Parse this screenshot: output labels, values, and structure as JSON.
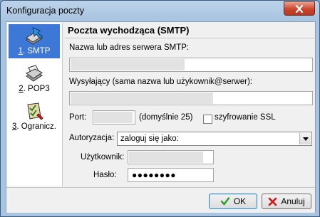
{
  "window": {
    "title": "Konfiguracja poczty"
  },
  "sidebar": {
    "items": [
      {
        "num": "1",
        "label": ". SMTP"
      },
      {
        "num": "2",
        "label": ". POP3"
      },
      {
        "num": "3",
        "label": ". Ogranicz."
      }
    ],
    "selected_index": 0
  },
  "panel": {
    "title": "Poczta wychodząca (SMTP)",
    "server_label": "Nazwa lub adres serwera SMTP:",
    "server_value": "",
    "sender_label": "Wysyłający (sama nazwa lub użykownik@serwer):",
    "sender_value": "",
    "port_label": "Port:",
    "port_value": "",
    "port_default": "(domyślnie 25)",
    "ssl_label": "szyfrowanie SSL",
    "ssl_checked": false,
    "auth_label": "Autoryzacja:",
    "auth_value": "zaloguj się jako:",
    "user_label": "Użytkownik:",
    "user_value": "",
    "password_label": "Hasło:",
    "password_value": "●●●●●●●●"
  },
  "buttons": {
    "ok": "OK",
    "cancel": "Anuluj"
  }
}
